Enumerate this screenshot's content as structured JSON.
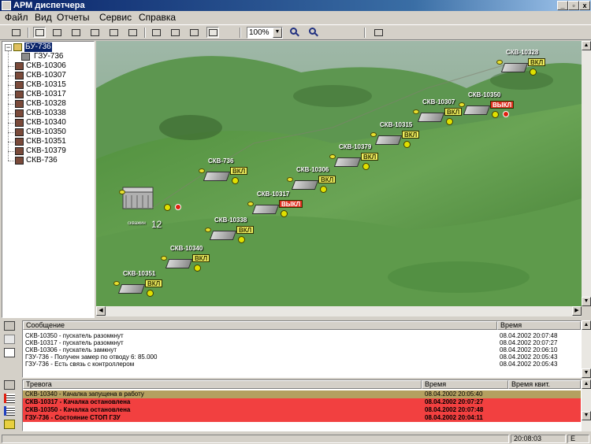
{
  "window": {
    "title": "АРМ диспетчера",
    "minimize": "_",
    "maximize": "▫",
    "close": "x"
  },
  "menu": [
    "Файл",
    "Вид",
    "Отчеты",
    "Сервис",
    "Справка"
  ],
  "toolbar": {
    "zoom_value": "100%"
  },
  "tree": {
    "root": "БУ-736",
    "items": [
      "ГЗУ-736",
      "СКВ-10306",
      "СКВ-10307",
      "СКВ-10315",
      "СКВ-10317",
      "СКВ-10328",
      "СКВ-10338",
      "СКВ-10340",
      "СКВ-10350",
      "СКВ-10351",
      "СКВ-10379",
      "СКВ-736"
    ]
  },
  "map": {
    "gzu_count": "12",
    "gzu_caption": "скважин",
    "wells": [
      {
        "name": "СКВ-10328",
        "state": "ВКЛ",
        "alarm": false
      },
      {
        "name": "СКВ-10350",
        "state": "ВЫКЛ",
        "alarm": true
      },
      {
        "name": "СКВ-10307",
        "state": "ВКЛ",
        "alarm": false
      },
      {
        "name": "СКВ-10315",
        "state": "ВКЛ",
        "alarm": false
      },
      {
        "name": "СКВ-10379",
        "state": "ВКЛ",
        "alarm": false
      },
      {
        "name": "СКВ-10306",
        "state": "ВКЛ",
        "alarm": false
      },
      {
        "name": "СКВ-736",
        "state": "ВКЛ",
        "alarm": false
      },
      {
        "name": "СКВ-10317",
        "state": "ВЫКЛ",
        "alarm": false
      },
      {
        "name": "СКВ-10338",
        "state": "ВКЛ",
        "alarm": false
      },
      {
        "name": "СКВ-10340",
        "state": "ВКЛ",
        "alarm": false
      },
      {
        "name": "СКВ-10351",
        "state": "ВКЛ",
        "alarm": false
      }
    ]
  },
  "messages": {
    "header_message": "Сообщение",
    "header_time": "Время",
    "rows": [
      {
        "text": "СКВ-10350 - пускатель разомкнут",
        "time": "08.04.2002 20:07:48"
      },
      {
        "text": "СКВ-10317 - пускатель разомкнут",
        "time": "08.04.2002 20:07:27"
      },
      {
        "text": "СКВ-10306 - пускатель замкнут",
        "time": "08.04.2002 20:06:10"
      },
      {
        "text": "ГЗУ-736 - Получен замер по отводу 6: 85.000",
        "time": "08.04.2002 20:05:43"
      },
      {
        "text": "ГЗУ-736 - Есть связь с контроллером",
        "time": "08.04.2002 20:05:43"
      }
    ]
  },
  "alarms": {
    "header_alarm": "Тревога",
    "header_time": "Время",
    "header_ack": "Время квит.",
    "rows": [
      {
        "text": "СКВ-10340 - Качалка запущена в работу",
        "time": "08.04.2002 20:05:40",
        "color": "#b4a060"
      },
      {
        "text": "СКВ-10317 - Качалка остановлена",
        "time": "08.04.2002 20:07:27",
        "color": "#f24040"
      },
      {
        "text": "СКВ-10350 - Качалка остановлена",
        "time": "08.04.2002 20:07:48",
        "color": "#f24040"
      },
      {
        "text": "ГЗУ-736 - Состояние СТОП ГЗУ",
        "time": "08.04.2002 20:04:11",
        "color": "#f24040"
      }
    ]
  },
  "status": {
    "clock": "20:08:03",
    "indicator": "E"
  }
}
